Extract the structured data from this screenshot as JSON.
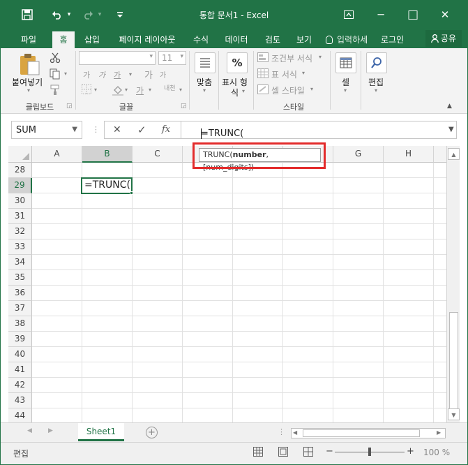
{
  "window": {
    "title": "통합 문서1 - Excel"
  },
  "titlebar": {
    "save_icon": "save-icon",
    "undo_icon": "undo-icon",
    "redo_icon": "redo-icon",
    "qat_more": "▾",
    "ribbon_display": "ribbon-display-icon",
    "minimize": "─",
    "maximize": "□",
    "close": "✕"
  },
  "tabs": [
    {
      "label": "파일"
    },
    {
      "label": "홈"
    },
    {
      "label": "삽입"
    },
    {
      "label": "페이지 레이아웃"
    },
    {
      "label": "수식"
    },
    {
      "label": "데이터"
    },
    {
      "label": "검토"
    },
    {
      "label": "보기"
    }
  ],
  "tell_me": "입력하세",
  "signin": "로그인",
  "share": "공유",
  "ribbon": {
    "paste": "붙여넣기",
    "clipboard": "클립보드",
    "font": "글꼴",
    "font_size": "11",
    "font_grow": "가",
    "font_shrink": "가",
    "bold": "가",
    "italic": "가",
    "underline": "가",
    "font_color": "가",
    "phonetic": "내천",
    "align": "맞춤",
    "number_format_label": "표시 형",
    "number_format_symbol": "%",
    "number_format_more": "식",
    "cond_format": "조건부 서식",
    "table_format": "표 서식",
    "cell_style": "셀 스타일",
    "styles": "스타일",
    "cells": "셀",
    "editing": "편집"
  },
  "formula_bar": {
    "name_box": "SUM",
    "cancel": "✕",
    "enter": "✓",
    "fx": "fx",
    "formula": "=TRUNC("
  },
  "tooltip": {
    "func": "TRUNC(",
    "arg1": "number",
    "rest": ", [num_digits])"
  },
  "grid": {
    "columns": [
      "A",
      "B",
      "C",
      "D",
      "E",
      "F",
      "G",
      "H"
    ],
    "selected_column": "B",
    "rows": [
      "28",
      "29",
      "30",
      "31",
      "32",
      "33",
      "34",
      "35",
      "36",
      "37",
      "38",
      "39",
      "40",
      "41",
      "42",
      "43",
      "44"
    ],
    "selected_row": "29",
    "active_cell_value": "=TRUNC("
  },
  "sheet": {
    "name": "Sheet1",
    "add": "+"
  },
  "status": {
    "mode": "편집",
    "zoom": "100 %",
    "zoom_minus": "−",
    "zoom_plus": "+"
  }
}
